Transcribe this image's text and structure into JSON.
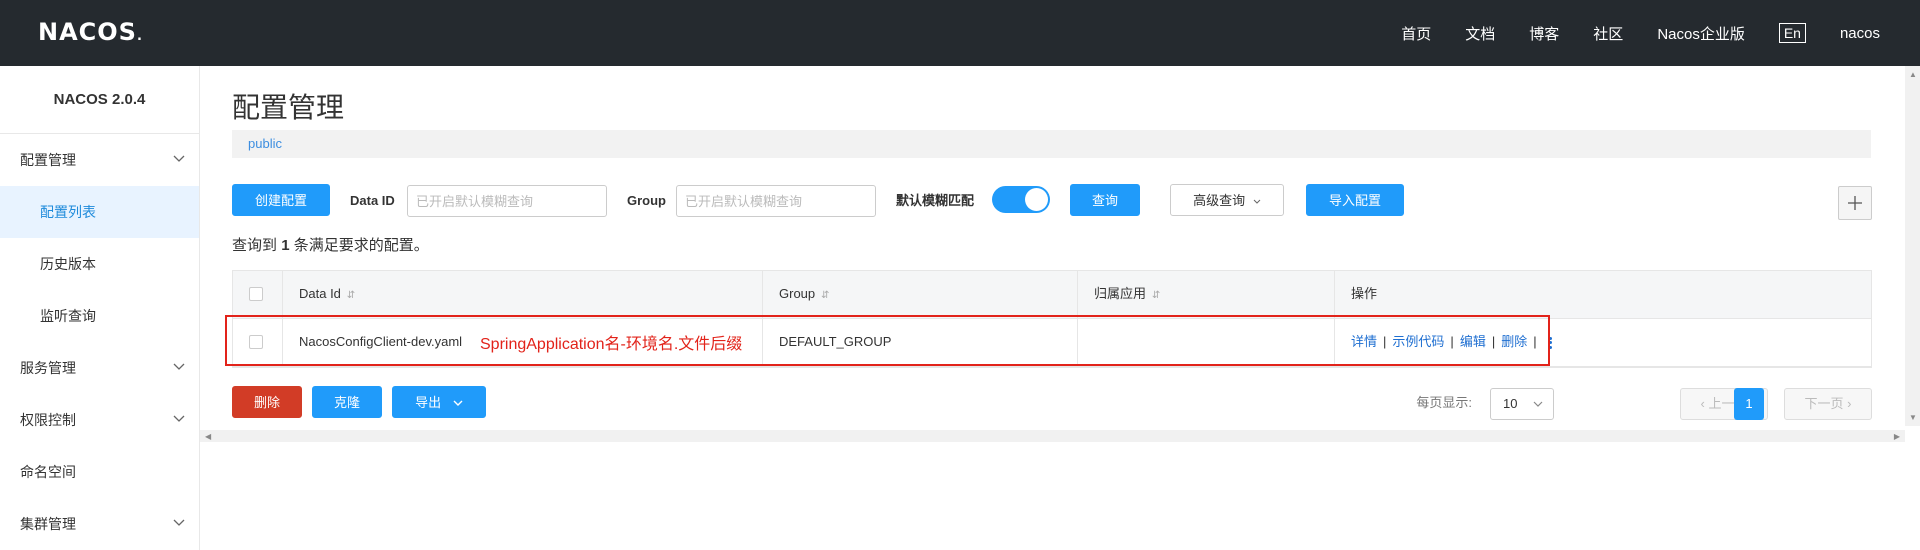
{
  "header": {
    "logo": "NACOS",
    "logo_dot": ".",
    "nav": [
      "首页",
      "文档",
      "博客",
      "社区",
      "Nacos企业版"
    ],
    "lang": "En",
    "user": "nacos"
  },
  "sidebar": {
    "version": "NACOS 2.0.4",
    "items": [
      {
        "label": "配置管理",
        "expandable": true
      },
      {
        "label": "配置列表",
        "sub": true,
        "active": true
      },
      {
        "label": "历史版本",
        "sub": true
      },
      {
        "label": "监听查询",
        "sub": true
      },
      {
        "label": "服务管理",
        "expandable": true
      },
      {
        "label": "权限控制",
        "expandable": true
      },
      {
        "label": "命名空间"
      },
      {
        "label": "集群管理",
        "expandable": true
      }
    ]
  },
  "main": {
    "title": "配置管理",
    "namespace": "public",
    "toolbar": {
      "create_label": "创建配置",
      "dataid_label": "Data ID",
      "dataid_placeholder": "已开启默认模糊查询",
      "group_label": "Group",
      "group_placeholder": "已开启默认模糊查询",
      "fuzzy_label": "默认模糊匹配",
      "fuzzy_on": true,
      "query_label": "查询",
      "advanced_label": "高级查询",
      "import_label": "导入配置"
    },
    "result": {
      "prefix": "查询到",
      "count": "1",
      "suffix": "条满足要求的配置。"
    },
    "table": {
      "columns": [
        "Data Id",
        "Group",
        "归属应用",
        "操作"
      ],
      "rows": [
        {
          "data_id": "NacosConfigClient-dev.yaml",
          "group": "DEFAULT_GROUP",
          "app": ""
        }
      ],
      "actions": [
        "详情",
        "示例代码",
        "编辑",
        "删除"
      ]
    },
    "annotation": "SpringApplication名-环境名.文件后缀",
    "bottom": {
      "delete_label": "删除",
      "clone_label": "克隆",
      "export_label": "导出",
      "page_size_label": "每页显示:",
      "page_size": "10",
      "prev_label": "上一页",
      "current_page": "1",
      "next_label": "下一页"
    }
  },
  "colors": {
    "primary": "#209bfa",
    "danger": "#d23c26",
    "header_bg": "#252a2f",
    "annotation": "#e2231a"
  }
}
